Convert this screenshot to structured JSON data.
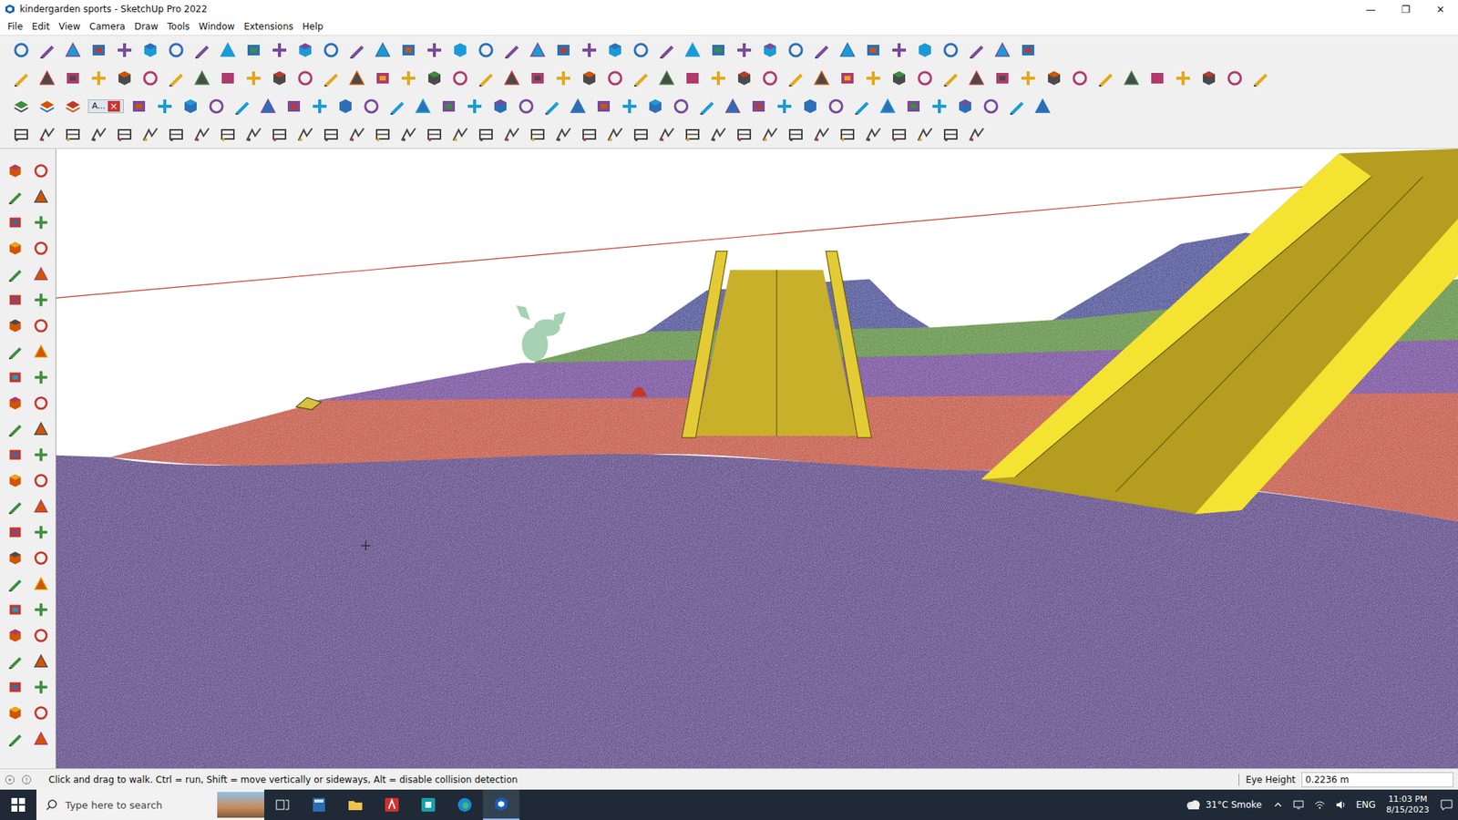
{
  "window": {
    "title": "kindergarden sports - SketchUp Pro 2022",
    "controls": [
      "—",
      "❐",
      "✕"
    ]
  },
  "menu": [
    "File",
    "Edit",
    "View",
    "Camera",
    "Draw",
    "Tools",
    "Window",
    "Extensions",
    "Help"
  ],
  "toolbar_tray": {
    "label": "A...",
    "close": "×"
  },
  "status_bar": {
    "hint": "Click and drag to walk. Ctrl = run, Shift = move vertically or sideways, Alt = disable collision detection",
    "measure_label": "Eye Height",
    "measure_value": "0.2236 m"
  },
  "taskbar": {
    "search_placeholder": "Type here to search",
    "weather": "31°C Smoke",
    "language": "ENG",
    "time": "11:03 PM",
    "date": "8/15/2023"
  }
}
